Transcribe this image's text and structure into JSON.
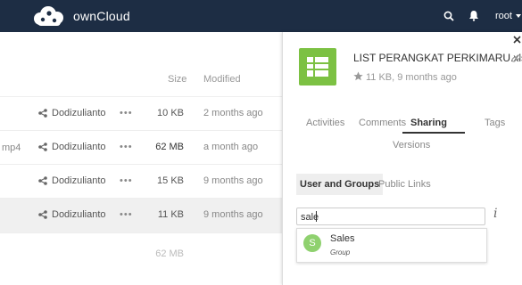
{
  "topbar": {
    "app_name": "ownCloud",
    "user": "root",
    "bg_color": "#1d2d44",
    "icons": [
      "search-icon",
      "bell-icon",
      "chevron-down-icon"
    ]
  },
  "filelist": {
    "columns": {
      "size": "Size",
      "modified": "Modified"
    },
    "rows": [
      {
        "name": "",
        "owner": "Dodizulianto",
        "actions": "•••",
        "size": "10 KB",
        "modified": "2 months ago",
        "selected": false
      },
      {
        "name": "mp4",
        "owner": "Dodizulianto",
        "actions": "•••",
        "size": "62 MB",
        "modified": "a month ago",
        "selected": false
      },
      {
        "name": "",
        "owner": "Dodizulianto",
        "actions": "•••",
        "size": "15 KB",
        "modified": "9 months ago",
        "selected": false
      },
      {
        "name": "",
        "owner": "Dodizulianto",
        "actions": "•••",
        "size": "11 KB",
        "modified": "9 months ago",
        "selected": true
      }
    ],
    "total_size": "62 MB"
  },
  "sidebar": {
    "file_title": "LIST PERANGKAT PERKIMARU.xlsx",
    "file_meta": "11 KB, 9 months ago",
    "thumb_color": "#7cc143",
    "tabs": {
      "activities": "Activities",
      "comments": "Comments",
      "sharing": "Sharing",
      "tags": "Tags",
      "versions": "Versions"
    },
    "subtabs": {
      "users_groups": "User and Groups",
      "public_links": "Public Links"
    },
    "share_input": {
      "value": "sale",
      "info": "i"
    },
    "autocomplete": {
      "initial": "S",
      "name": "Sales",
      "type": "Group",
      "avatar_color": "#8fd16f"
    }
  }
}
